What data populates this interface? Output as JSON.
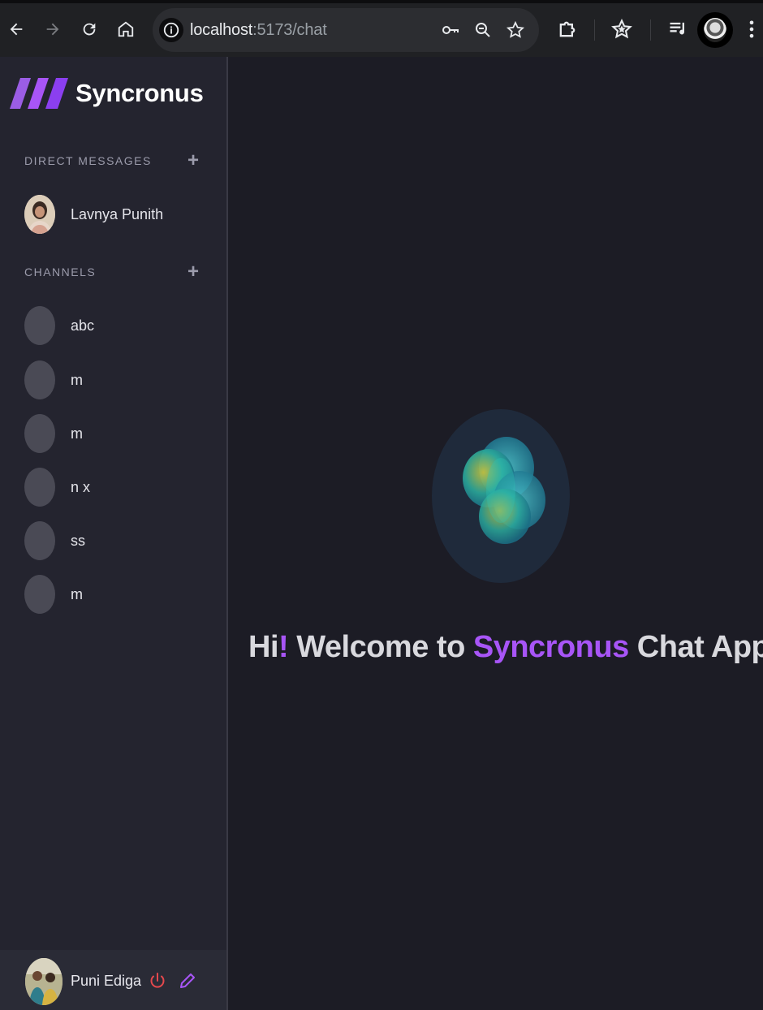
{
  "browser": {
    "url_host": "localhost",
    "url_path": ":5173/chat"
  },
  "app": {
    "name": "Syncronus",
    "accent_color": "#a855f7"
  },
  "sidebar": {
    "direct_messages_title": "DIRECT MESSAGES",
    "channels_title": "CHANNELS",
    "dm_contacts": [
      {
        "name": "Lavnya Punith"
      }
    ],
    "channels": [
      {
        "name": "abc"
      },
      {
        "name": "m"
      },
      {
        "name": "m"
      },
      {
        "name": "n x"
      },
      {
        "name": "ss"
      },
      {
        "name": "m"
      }
    ]
  },
  "user": {
    "name": "Puni Ediga"
  },
  "welcome": {
    "hi": "Hi",
    "bang": "!",
    "welcome_to": " Welcome to ",
    "brand": "Syncronus",
    "rest": " Chat App",
    "period": "."
  }
}
